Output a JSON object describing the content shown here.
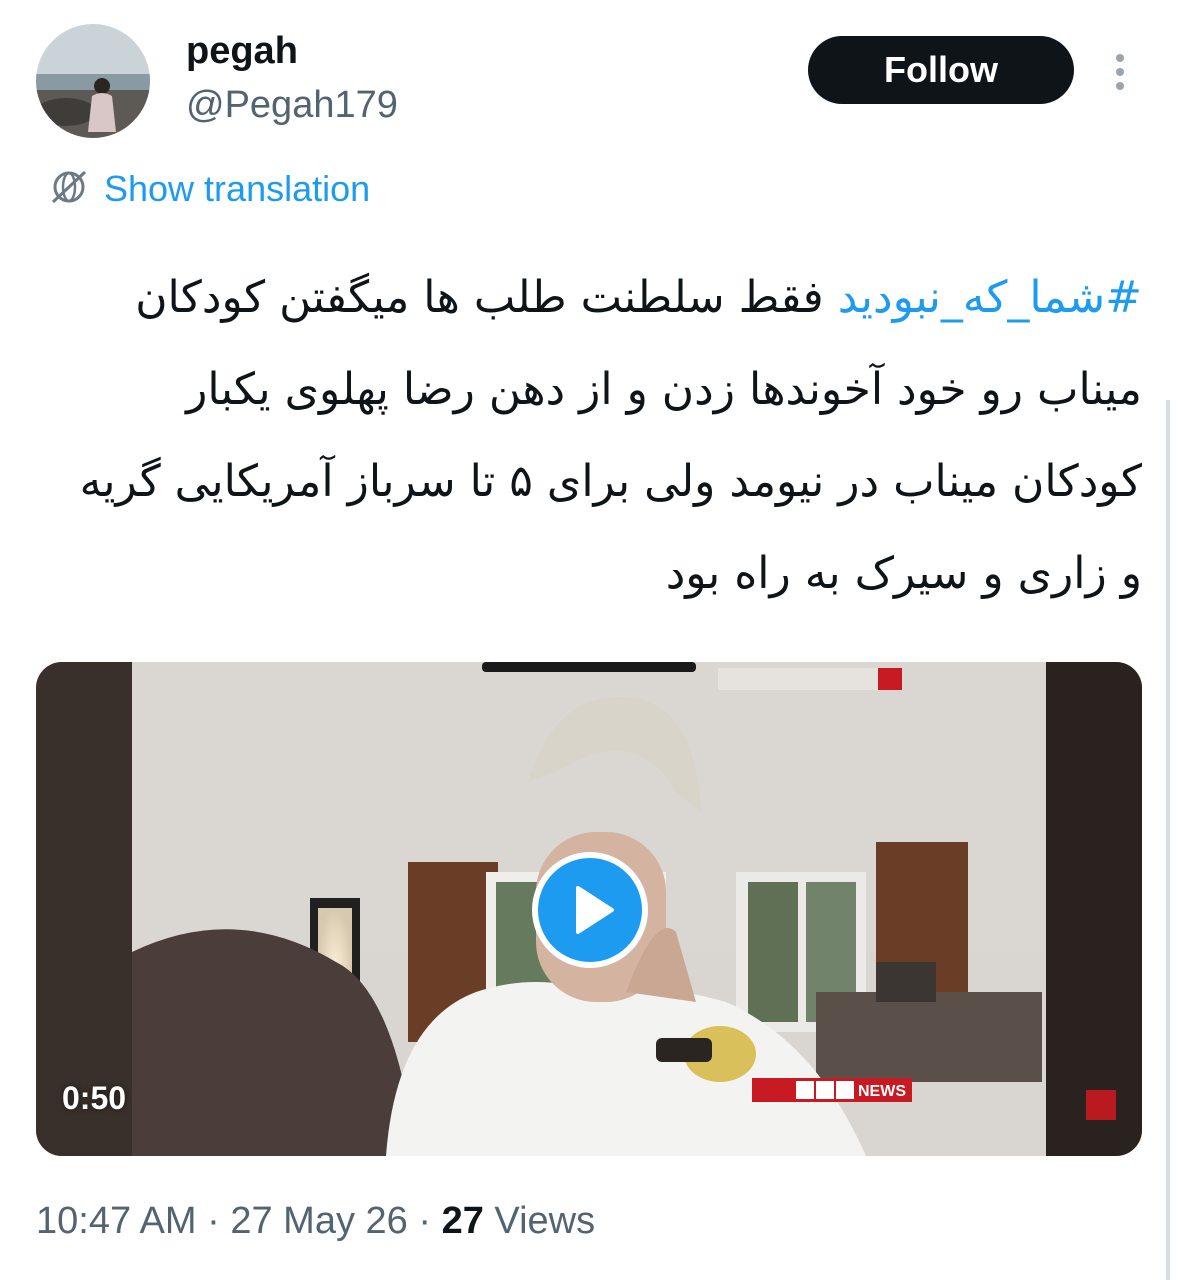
{
  "author": {
    "name": "pegah",
    "handle": "@Pegah179",
    "avatar_icon": "avatar-photo-beach"
  },
  "actions": {
    "follow_label": "Follow",
    "more_icon": "more-vertical-icon"
  },
  "translation": {
    "label": "Show translation",
    "icon": "translate-globe-icon"
  },
  "tweet": {
    "hashtag": "#شما_که_نبودید",
    "text": " فقط سلطنت طلب ها میگفتن کودکان میناب رو خود آخوندها زدن و از دهن رضا پهلوی یکبار کودکان میناب در نیومد ولی برای ۵ تا سرباز آمریکایی گریه و زاری و سیرک به راه بود"
  },
  "media": {
    "duration": "0:50",
    "play_icon": "play-icon",
    "watermark": "BBC NEWS فارسی",
    "colors": {
      "play": "#1d9bf0"
    }
  },
  "meta": {
    "time": "10:47 AM",
    "sep1": " · ",
    "date": "27 May 26",
    "sep2": " · ",
    "views_count": "27",
    "views_label": " Views"
  },
  "colors": {
    "accent": "#1d9bf0",
    "text": "#0f1419",
    "muted": "#536471"
  }
}
